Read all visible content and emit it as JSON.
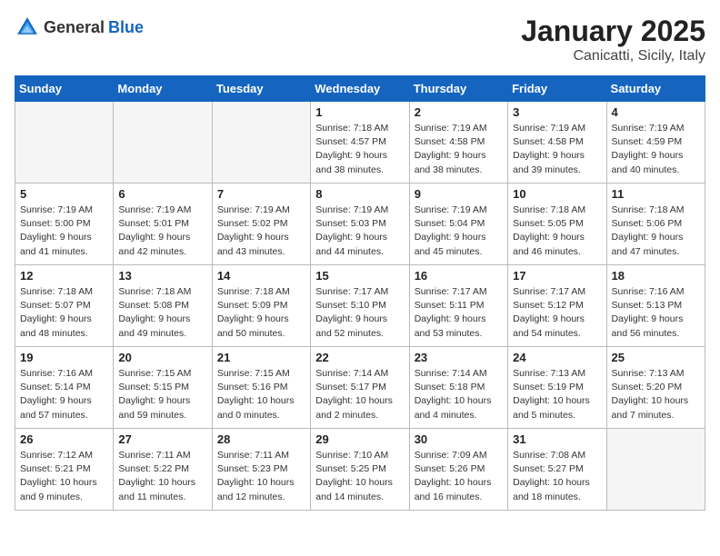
{
  "header": {
    "logo_general": "General",
    "logo_blue": "Blue",
    "month": "January 2025",
    "location": "Canicatti, Sicily, Italy"
  },
  "weekdays": [
    "Sunday",
    "Monday",
    "Tuesday",
    "Wednesday",
    "Thursday",
    "Friday",
    "Saturday"
  ],
  "weeks": [
    [
      {
        "day": "",
        "info": ""
      },
      {
        "day": "",
        "info": ""
      },
      {
        "day": "",
        "info": ""
      },
      {
        "day": "1",
        "info": "Sunrise: 7:18 AM\nSunset: 4:57 PM\nDaylight: 9 hours and 38 minutes."
      },
      {
        "day": "2",
        "info": "Sunrise: 7:19 AM\nSunset: 4:58 PM\nDaylight: 9 hours and 38 minutes."
      },
      {
        "day": "3",
        "info": "Sunrise: 7:19 AM\nSunset: 4:58 PM\nDaylight: 9 hours and 39 minutes."
      },
      {
        "day": "4",
        "info": "Sunrise: 7:19 AM\nSunset: 4:59 PM\nDaylight: 9 hours and 40 minutes."
      }
    ],
    [
      {
        "day": "5",
        "info": "Sunrise: 7:19 AM\nSunset: 5:00 PM\nDaylight: 9 hours and 41 minutes."
      },
      {
        "day": "6",
        "info": "Sunrise: 7:19 AM\nSunset: 5:01 PM\nDaylight: 9 hours and 42 minutes."
      },
      {
        "day": "7",
        "info": "Sunrise: 7:19 AM\nSunset: 5:02 PM\nDaylight: 9 hours and 43 minutes."
      },
      {
        "day": "8",
        "info": "Sunrise: 7:19 AM\nSunset: 5:03 PM\nDaylight: 9 hours and 44 minutes."
      },
      {
        "day": "9",
        "info": "Sunrise: 7:19 AM\nSunset: 5:04 PM\nDaylight: 9 hours and 45 minutes."
      },
      {
        "day": "10",
        "info": "Sunrise: 7:18 AM\nSunset: 5:05 PM\nDaylight: 9 hours and 46 minutes."
      },
      {
        "day": "11",
        "info": "Sunrise: 7:18 AM\nSunset: 5:06 PM\nDaylight: 9 hours and 47 minutes."
      }
    ],
    [
      {
        "day": "12",
        "info": "Sunrise: 7:18 AM\nSunset: 5:07 PM\nDaylight: 9 hours and 48 minutes."
      },
      {
        "day": "13",
        "info": "Sunrise: 7:18 AM\nSunset: 5:08 PM\nDaylight: 9 hours and 49 minutes."
      },
      {
        "day": "14",
        "info": "Sunrise: 7:18 AM\nSunset: 5:09 PM\nDaylight: 9 hours and 50 minutes."
      },
      {
        "day": "15",
        "info": "Sunrise: 7:17 AM\nSunset: 5:10 PM\nDaylight: 9 hours and 52 minutes."
      },
      {
        "day": "16",
        "info": "Sunrise: 7:17 AM\nSunset: 5:11 PM\nDaylight: 9 hours and 53 minutes."
      },
      {
        "day": "17",
        "info": "Sunrise: 7:17 AM\nSunset: 5:12 PM\nDaylight: 9 hours and 54 minutes."
      },
      {
        "day": "18",
        "info": "Sunrise: 7:16 AM\nSunset: 5:13 PM\nDaylight: 9 hours and 56 minutes."
      }
    ],
    [
      {
        "day": "19",
        "info": "Sunrise: 7:16 AM\nSunset: 5:14 PM\nDaylight: 9 hours and 57 minutes."
      },
      {
        "day": "20",
        "info": "Sunrise: 7:15 AM\nSunset: 5:15 PM\nDaylight: 9 hours and 59 minutes."
      },
      {
        "day": "21",
        "info": "Sunrise: 7:15 AM\nSunset: 5:16 PM\nDaylight: 10 hours and 0 minutes."
      },
      {
        "day": "22",
        "info": "Sunrise: 7:14 AM\nSunset: 5:17 PM\nDaylight: 10 hours and 2 minutes."
      },
      {
        "day": "23",
        "info": "Sunrise: 7:14 AM\nSunset: 5:18 PM\nDaylight: 10 hours and 4 minutes."
      },
      {
        "day": "24",
        "info": "Sunrise: 7:13 AM\nSunset: 5:19 PM\nDaylight: 10 hours and 5 minutes."
      },
      {
        "day": "25",
        "info": "Sunrise: 7:13 AM\nSunset: 5:20 PM\nDaylight: 10 hours and 7 minutes."
      }
    ],
    [
      {
        "day": "26",
        "info": "Sunrise: 7:12 AM\nSunset: 5:21 PM\nDaylight: 10 hours and 9 minutes."
      },
      {
        "day": "27",
        "info": "Sunrise: 7:11 AM\nSunset: 5:22 PM\nDaylight: 10 hours and 11 minutes."
      },
      {
        "day": "28",
        "info": "Sunrise: 7:11 AM\nSunset: 5:23 PM\nDaylight: 10 hours and 12 minutes."
      },
      {
        "day": "29",
        "info": "Sunrise: 7:10 AM\nSunset: 5:25 PM\nDaylight: 10 hours and 14 minutes."
      },
      {
        "day": "30",
        "info": "Sunrise: 7:09 AM\nSunset: 5:26 PM\nDaylight: 10 hours and 16 minutes."
      },
      {
        "day": "31",
        "info": "Sunrise: 7:08 AM\nSunset: 5:27 PM\nDaylight: 10 hours and 18 minutes."
      },
      {
        "day": "",
        "info": ""
      }
    ]
  ]
}
